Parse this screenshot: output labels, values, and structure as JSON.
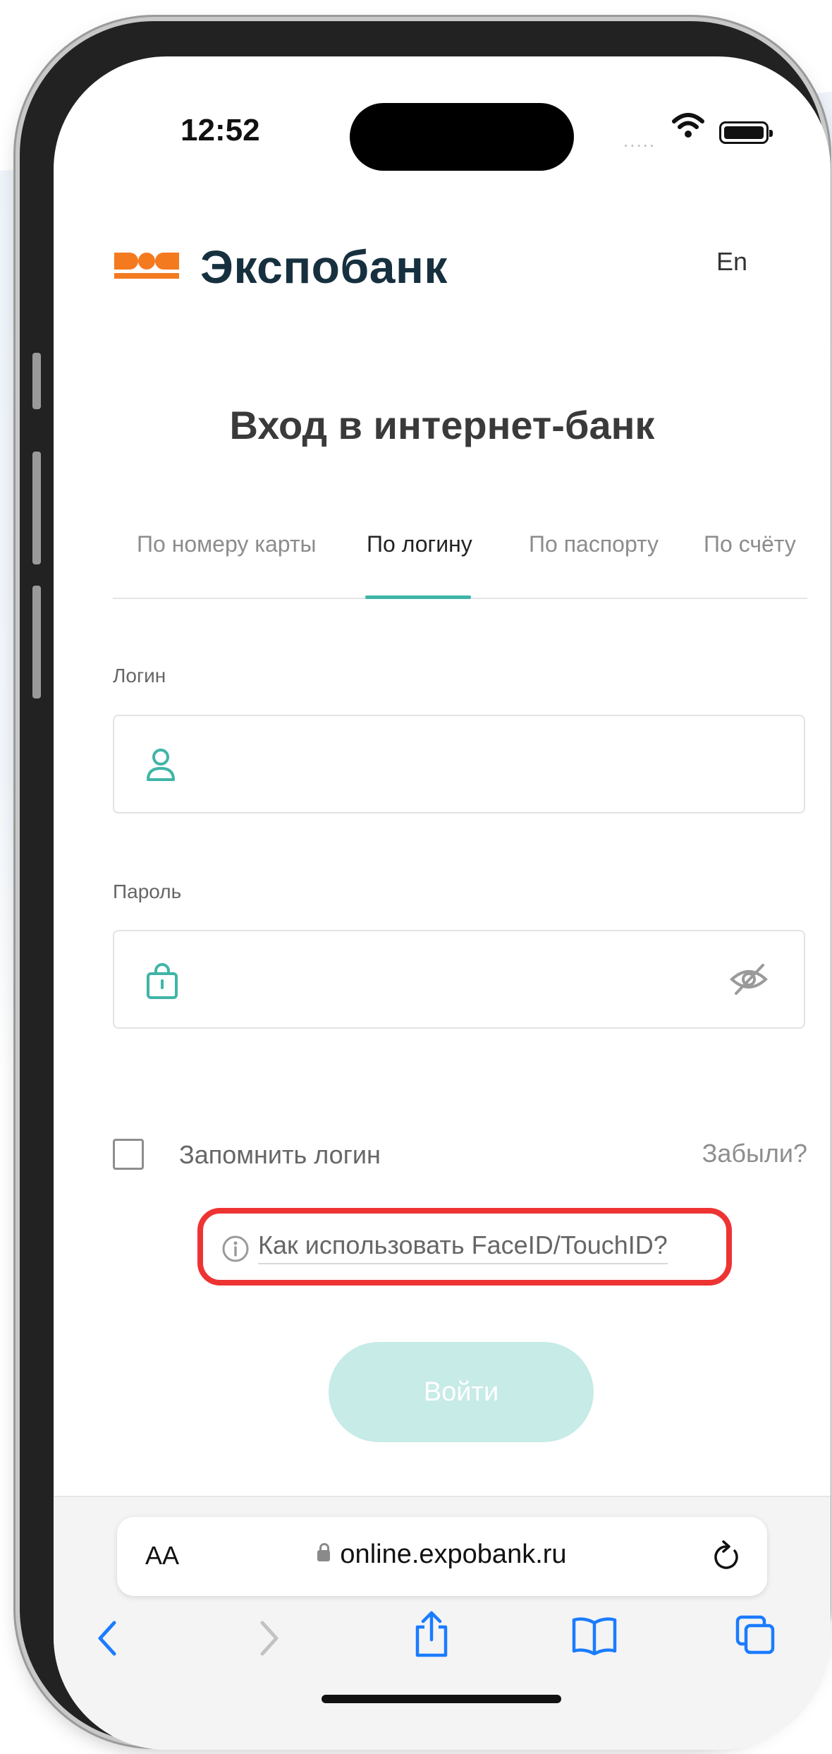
{
  "status_bar": {
    "time": "12:52",
    "signal": "....."
  },
  "header": {
    "brand": "Экспобанк",
    "lang": "En"
  },
  "page": {
    "title": "Вход в интернет-банк"
  },
  "tabs": [
    {
      "label": "По номеру карты",
      "active": false
    },
    {
      "label": "По логину",
      "active": true
    },
    {
      "label": "По паспорту",
      "active": false
    },
    {
      "label": "По счёту",
      "active": false
    }
  ],
  "form": {
    "login": {
      "label": "Логин",
      "value": ""
    },
    "password": {
      "label": "Пароль",
      "value": ""
    },
    "remember_label": "Запомнить логин",
    "remember_checked": false,
    "forgot_label": "Забыли?",
    "faceid_help": "Как использовать FaceID/TouchID?",
    "submit_label": "Войти"
  },
  "browser": {
    "text_size_label": "AA",
    "url": "online.expobank.ru"
  },
  "colors": {
    "brand_orange": "#f47a20",
    "brand_navy": "#16303f",
    "accent_teal": "#3fb5a7",
    "disabled_button": "#c7ebe7",
    "highlight_red": "#ee3333",
    "safari_blue": "#1a7cff"
  },
  "icons": {
    "login_field": "person-icon",
    "password_field": "lock-bag-icon",
    "password_toggle": "eye-slash-icon",
    "faceid_help": "info-icon",
    "browser_reload": "reload-icon",
    "toolbar": [
      "back-icon",
      "forward-icon",
      "share-icon",
      "bookmarks-icon",
      "tabs-icon"
    ]
  }
}
